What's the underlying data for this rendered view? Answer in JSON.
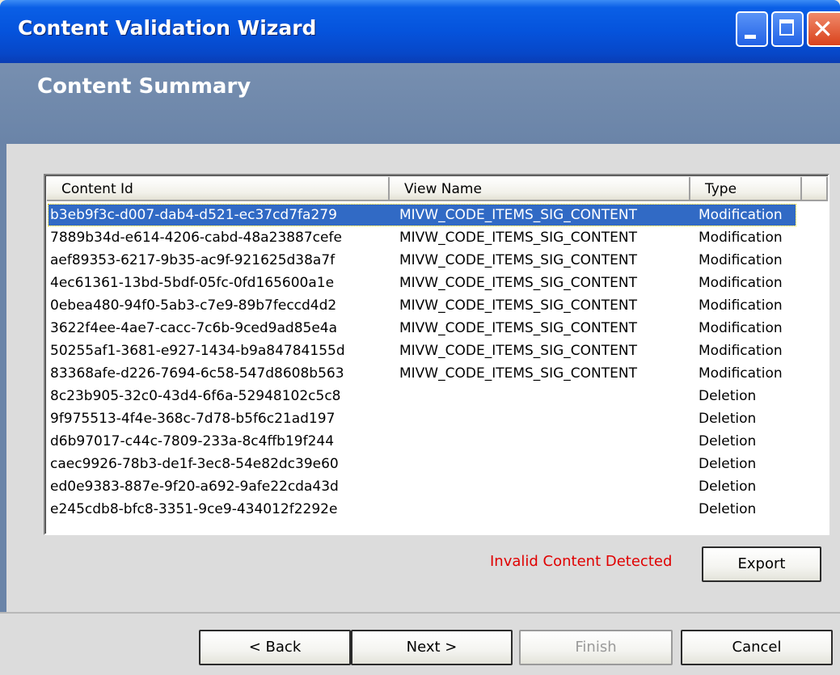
{
  "window": {
    "title": "Content Validation Wizard"
  },
  "header": {
    "heading": "Content Summary"
  },
  "table": {
    "columns": [
      "Content Id",
      "View Name",
      "Type"
    ],
    "rows": [
      {
        "id": "b3eb9f3c-d007-dab4-d521-ec37cd7fa279",
        "view": "MIVW_CODE_ITEMS_SIG_CONTENT",
        "type": "Modification"
      },
      {
        "id": "7889b34d-e614-4206-cabd-48a23887cefe",
        "view": "MIVW_CODE_ITEMS_SIG_CONTENT",
        "type": "Modification"
      },
      {
        "id": "aef89353-6217-9b35-ac9f-921625d38a7f",
        "view": "MIVW_CODE_ITEMS_SIG_CONTENT",
        "type": "Modification"
      },
      {
        "id": "4ec61361-13bd-5bdf-05fc-0fd165600a1e",
        "view": "MIVW_CODE_ITEMS_SIG_CONTENT",
        "type": "Modification"
      },
      {
        "id": "0ebea480-94f0-5ab3-c7e9-89b7feccd4d2",
        "view": "MIVW_CODE_ITEMS_SIG_CONTENT",
        "type": "Modification"
      },
      {
        "id": "3622f4ee-4ae7-cacc-7c6b-9ced9ad85e4a",
        "view": "MIVW_CODE_ITEMS_SIG_CONTENT",
        "type": "Modification"
      },
      {
        "id": "50255af1-3681-e927-1434-b9a84784155d",
        "view": "MIVW_CODE_ITEMS_SIG_CONTENT",
        "type": "Modification"
      },
      {
        "id": "83368afe-d226-7694-6c58-547d8608b563",
        "view": "MIVW_CODE_ITEMS_SIG_CONTENT",
        "type": "Modification"
      },
      {
        "id": "8c23b905-32c0-43d4-6f6a-52948102c5c8",
        "view": "",
        "type": "Deletion"
      },
      {
        "id": "9f975513-4f4e-368c-7d78-b5f6c21ad197",
        "view": "",
        "type": "Deletion"
      },
      {
        "id": "d6b97017-c44c-7809-233a-8c4ffb19f244",
        "view": "",
        "type": "Deletion"
      },
      {
        "id": "caec9926-78b3-de1f-3ec8-54e82dc39e60",
        "view": "",
        "type": "Deletion"
      },
      {
        "id": "ed0e9383-887e-9f20-a692-9afe22cda43d",
        "view": "",
        "type": "Deletion"
      },
      {
        "id": "e245cdb8-bfc8-3351-9ce9-434012f2292e",
        "view": "",
        "type": "Deletion"
      }
    ]
  },
  "status": {
    "message": "Invalid Content Detected",
    "color": "#e00000"
  },
  "buttons": {
    "export": "Export",
    "back": "< Back",
    "next": "Next >",
    "finish": "Finish",
    "cancel": "Cancel"
  },
  "colors": {
    "titlebar": "#0553dc",
    "header_band": "#6a84a8",
    "selection": "#316ac5"
  },
  "icons": {
    "minimize": "minimize-icon",
    "maximize": "maximize-icon",
    "close": "close-icon"
  }
}
